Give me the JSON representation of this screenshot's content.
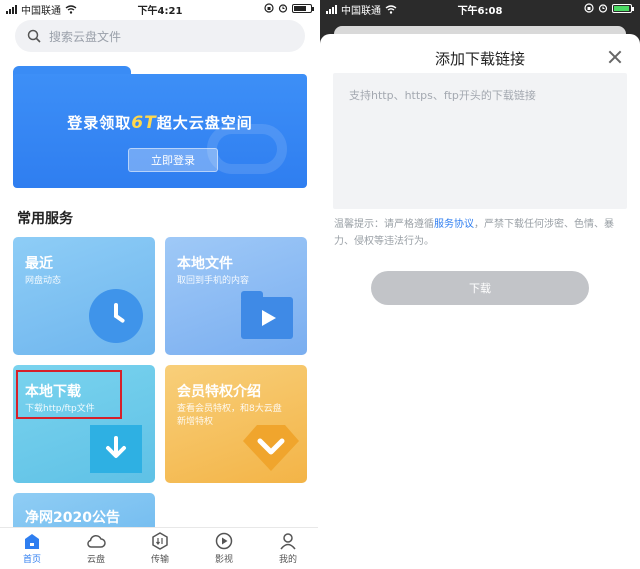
{
  "left_screen": {
    "status_bar": {
      "carrier": "中国联通",
      "time": "下午4:21",
      "icons": [
        "signal-icon",
        "wifi-icon",
        "rotation-lock-icon",
        "alarm-icon",
        "battery-icon"
      ]
    },
    "search": {
      "placeholder": "搜索云盘文件",
      "icon": "search-icon"
    },
    "banner": {
      "title_prefix": "登录领取",
      "title_accent": "6T",
      "title_suffix": "超大云盘空间",
      "button_label": "立即登录"
    },
    "section_title": "常用服务",
    "cards": {
      "recent": {
        "title": "最近",
        "subtitle": "网盘动态",
        "icon": "clock-icon"
      },
      "local_files": {
        "title": "本地文件",
        "subtitle": "取回到手机的内容",
        "icon": "folder-play-icon"
      },
      "local_download": {
        "title": "本地下载",
        "subtitle": "下载http/ftp文件",
        "icon": "download-arrow-icon"
      },
      "vip": {
        "title": "会员特权介绍",
        "subtitle": "查看会员特权，和8大云盘新增特权",
        "icon": "diamond-chevron-icon"
      },
      "notice": {
        "title": "净网2020公告"
      }
    },
    "tabbar": {
      "items": [
        {
          "label": "首页",
          "icon": "home-icon",
          "active": true
        },
        {
          "label": "云盘",
          "icon": "cloud-icon",
          "active": false
        },
        {
          "label": "传输",
          "icon": "transfer-icon",
          "active": false
        },
        {
          "label": "影视",
          "icon": "play-circle-icon",
          "active": false
        },
        {
          "label": "我的",
          "icon": "user-icon",
          "active": false
        }
      ]
    }
  },
  "right_screen": {
    "status_bar": {
      "carrier": "中国联通",
      "time": "下午6:08",
      "icons": [
        "signal-icon",
        "wifi-icon",
        "rotation-lock-icon",
        "alarm-icon",
        "battery-icon"
      ]
    },
    "dialog": {
      "title": "添加下载链接",
      "close_icon": "close-icon",
      "link_placeholder": "支持http、https、ftp开头的下载链接",
      "tip_prefix": "温馨提示：请严格遵循",
      "tip_link": "服务协议",
      "tip_suffix": "，严禁下载任何涉密、色情、暴力、侵权等违法行为。",
      "download_button": "下载"
    }
  },
  "colors": {
    "brand_blue": "#2f7ef0",
    "highlight_red": "#d6202a",
    "disabled_button": "#c2c4c8",
    "accent_yellow": "#ffd84d"
  }
}
